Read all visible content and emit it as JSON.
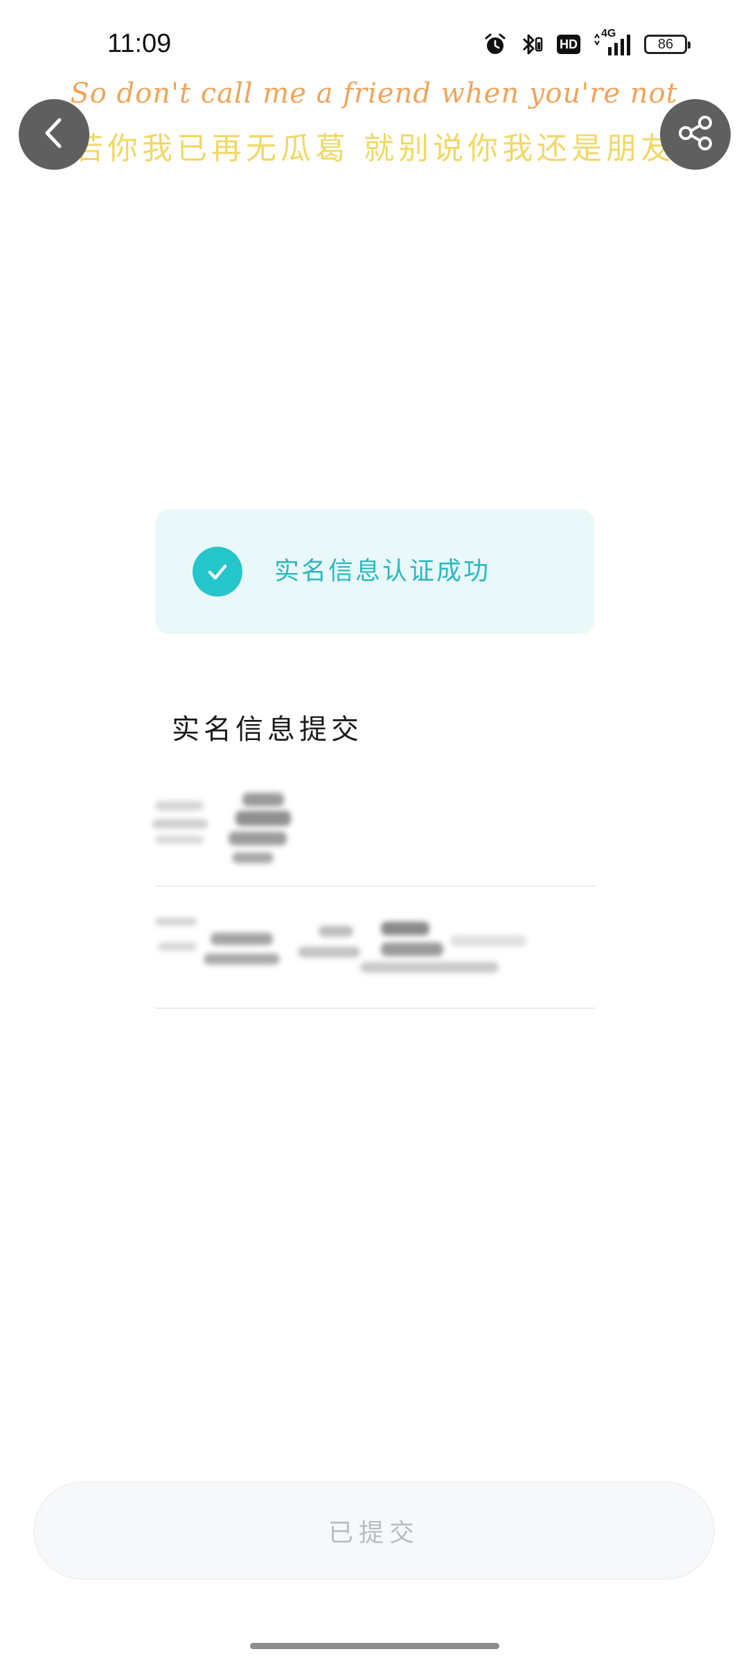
{
  "status_bar": {
    "time": "11:09",
    "network": "4G",
    "hd_label": "HD",
    "battery_level": "86",
    "icons": [
      "alarm-icon",
      "bluetooth-icon",
      "hd-icon",
      "signal-icon",
      "battery-icon"
    ]
  },
  "lyrics": {
    "english": "So don't call me a friend when you're not",
    "chinese": "若你我已再无瓜葛 就别说你我还是朋友"
  },
  "nav": {
    "back_icon": "chevron-left-icon",
    "share_icon": "share-icon"
  },
  "success_banner": {
    "icon": "check-circle-icon",
    "text": "实名信息认证成功"
  },
  "submitted_section": {
    "title": "实名信息提交"
  },
  "submit_button": {
    "label": "已提交",
    "enabled": false
  },
  "colors": {
    "accent": "#25c5cc",
    "accent_text": "#2ab8c2",
    "banner_bg": "#eaf8fa",
    "lyric_en": "#f0a45a",
    "lyric_zh": "#f1d866",
    "button_text_disabled": "#b8bcc2"
  }
}
